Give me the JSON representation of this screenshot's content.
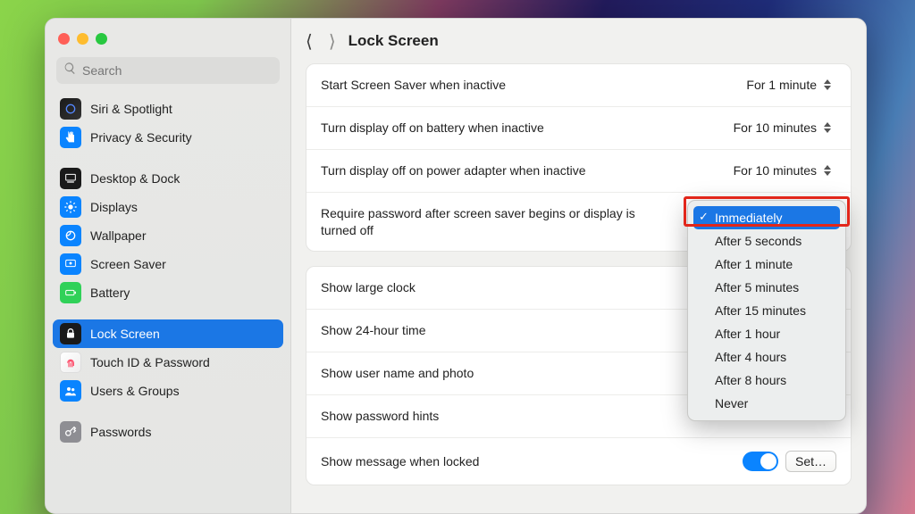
{
  "header": {
    "title": "Lock Screen",
    "back_enabled": true,
    "forward_enabled": false
  },
  "search": {
    "placeholder": "Search"
  },
  "sidebar": {
    "items": [
      {
        "id": "siri",
        "label": "Siri & Spotlight",
        "icon": "siri-icon"
      },
      {
        "id": "privacy",
        "label": "Privacy & Security",
        "icon": "hand-icon"
      },
      {
        "id": "desktop",
        "label": "Desktop & Dock",
        "icon": "dock-icon"
      },
      {
        "id": "displays",
        "label": "Displays",
        "icon": "sun-icon"
      },
      {
        "id": "wallpaper",
        "label": "Wallpaper",
        "icon": "wallpaper-icon"
      },
      {
        "id": "screensaver",
        "label": "Screen Saver",
        "icon": "screensaver-icon"
      },
      {
        "id": "battery",
        "label": "Battery",
        "icon": "battery-icon"
      },
      {
        "id": "lockscreen",
        "label": "Lock Screen",
        "icon": "lock-icon",
        "active": true
      },
      {
        "id": "touchid",
        "label": "Touch ID & Password",
        "icon": "fingerprint-icon"
      },
      {
        "id": "users",
        "label": "Users & Groups",
        "icon": "users-icon"
      },
      {
        "id": "passwords",
        "label": "Passwords",
        "icon": "key-icon"
      }
    ]
  },
  "settings": {
    "group1": [
      {
        "label": "Start Screen Saver when inactive",
        "value": "For 1 minute"
      },
      {
        "label": "Turn display off on battery when inactive",
        "value": "For 10 minutes"
      },
      {
        "label": "Turn display off on power adapter when inactive",
        "value": "For 10 minutes"
      },
      {
        "label": "Require password after screen saver begins or display is turned off",
        "value": "Immediately"
      }
    ],
    "group2": [
      {
        "label": "Show large clock"
      },
      {
        "label": "Show 24-hour time"
      },
      {
        "label": "Show user name and photo"
      },
      {
        "label": "Show password hints"
      },
      {
        "label": "Show message when locked",
        "toggle": true,
        "button": "Set…"
      }
    ]
  },
  "dropdown": {
    "selected_index": 0,
    "options": [
      "Immediately",
      "After 5 seconds",
      "After 1 minute",
      "After 5 minutes",
      "After 15 minutes",
      "After 1 hour",
      "After 4 hours",
      "After 8 hours",
      "Never"
    ]
  }
}
